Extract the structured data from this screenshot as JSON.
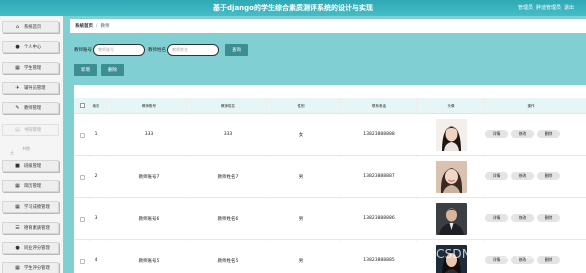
{
  "app": {
    "title": "基于django的学生综合素质测评系统的设计与实现",
    "top_right": [
      "管理员",
      "胖迪管理员",
      "退出"
    ]
  },
  "sidebar": {
    "items": [
      {
        "label": "系统首页",
        "icon": "home-icon",
        "glyph": "⌂",
        "active": false
      },
      {
        "label": "个人中心",
        "icon": "user-icon",
        "glyph": "●",
        "active": false
      },
      {
        "label": "学生管理",
        "icon": "grid-icon",
        "glyph": "▦",
        "active": false
      },
      {
        "label": "辅导员管理",
        "icon": "plane-icon",
        "glyph": "✈",
        "active": false
      },
      {
        "label": "教师管理",
        "icon": "edit-icon",
        "glyph": "✎",
        "active": false
      },
      {
        "label": "书院管理",
        "icon": "book-icon",
        "glyph": "▤",
        "active": true
      },
      {
        "label": "班级管理",
        "icon": "lock-icon",
        "glyph": "■",
        "active": false
      },
      {
        "label": "简历管理",
        "icon": "grid-icon",
        "glyph": "▦",
        "active": false
      },
      {
        "label": "学习成绩管理",
        "icon": "grid-icon",
        "glyph": "▦",
        "active": false
      },
      {
        "label": "德育素质管理",
        "icon": "list-icon",
        "glyph": "☰",
        "active": false
      },
      {
        "label": "同业评分管理",
        "icon": "user-icon",
        "glyph": "●",
        "active": false
      },
      {
        "label": "学生评分管理",
        "icon": "grid-icon",
        "glyph": "▦",
        "active": false
      }
    ],
    "submenu": "书院"
  },
  "breadcrumb": {
    "home": "系统首页",
    "sep": "/",
    "current": "教师"
  },
  "search": {
    "label1": "教师账号",
    "placeholder1": "教师账号",
    "label2": "教师姓名",
    "placeholder2": "教师姓名",
    "query": "查询"
  },
  "toolbar": {
    "add": "新增",
    "delete": "删除"
  },
  "table": {
    "headers": [
      "索引",
      "教师账号",
      "教师姓名",
      "性别",
      "联系电话",
      "头像",
      "操作"
    ],
    "rows": [
      {
        "index": "1",
        "account": "333",
        "name": "333",
        "gender": "女",
        "phone": "13823888888",
        "avatar": "avatar-woman-dark-hair"
      },
      {
        "index": "2",
        "account": "教师账号7",
        "name": "教师姓名7",
        "gender": "男",
        "phone": "13823888887",
        "avatar": "avatar-woman-smiling"
      },
      {
        "index": "3",
        "account": "教师账号6",
        "name": "教师姓名6",
        "gender": "男",
        "phone": "13823888886",
        "avatar": "avatar-man-suit"
      },
      {
        "index": "4",
        "account": "教师账号5",
        "name": "教师姓名5",
        "gender": "男",
        "phone": "13823888885",
        "avatar": "avatar-woman-dark-background"
      }
    ],
    "actions": [
      "详情",
      "修改",
      "删除"
    ]
  },
  "watermark": "CSDN @一点毕设",
  "colors": {
    "accent": "#3c8e92",
    "background": "#7fcfd3",
    "topbar": "#3bb3be"
  }
}
